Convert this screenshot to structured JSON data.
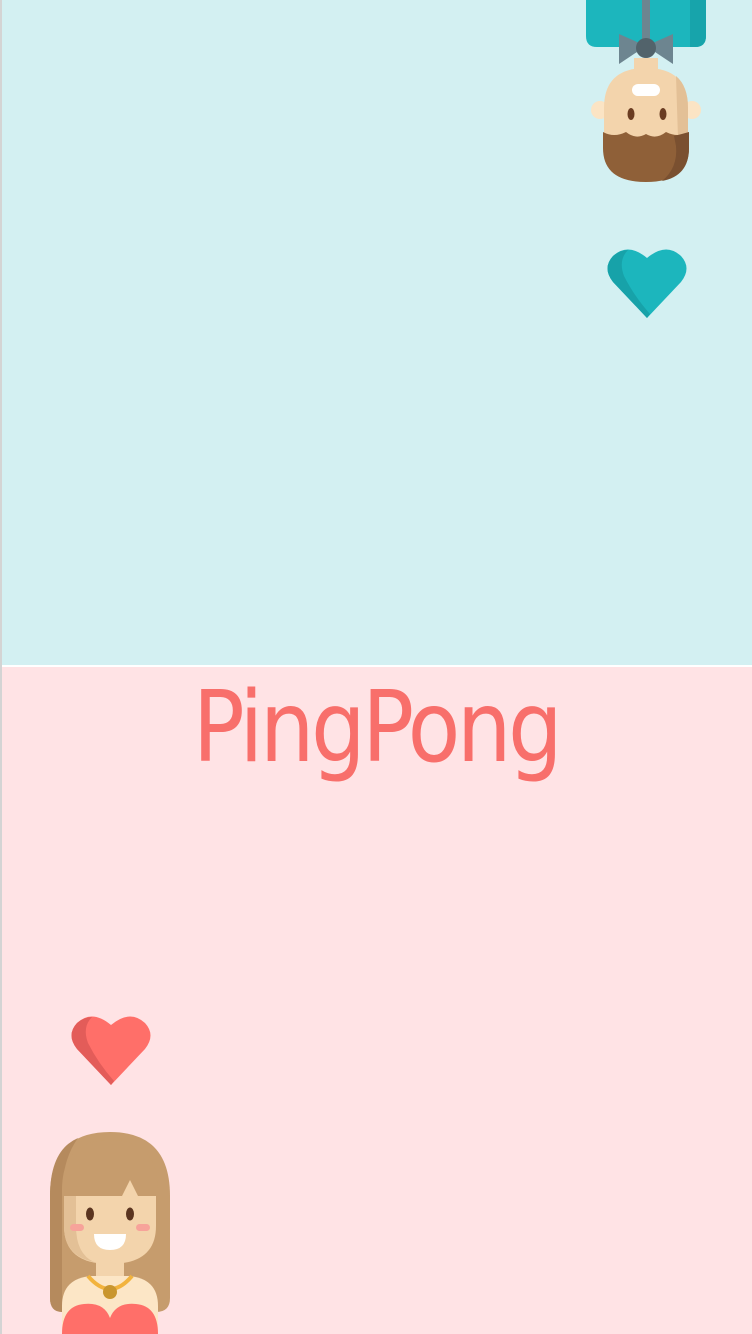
{
  "app": {
    "title": "PingPong"
  },
  "players": {
    "top": {
      "avatar": "bearded-man-avatar-icon",
      "accent": "#1cb6bd"
    },
    "bottom": {
      "avatar": "girl-avatar-icon",
      "accent": "#f86f6b"
    }
  },
  "colors": {
    "top_background": "#d3f0f2",
    "bottom_background": "#ffe3e5",
    "title": "#f86f6b",
    "top_heart": "#1cb6bd",
    "bottom_heart": "#ff6f69"
  }
}
